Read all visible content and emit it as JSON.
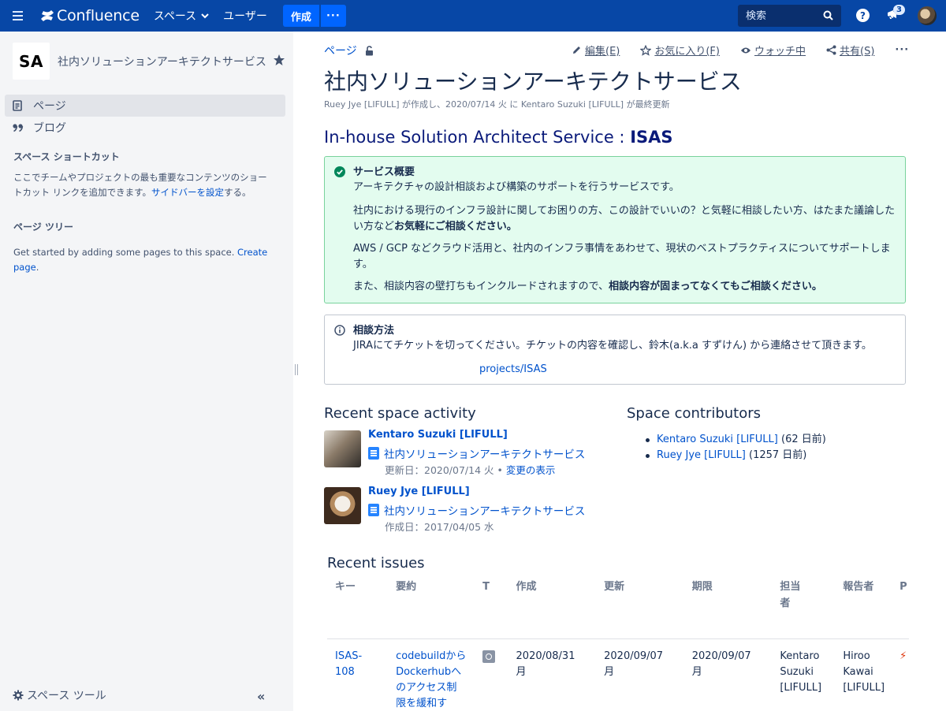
{
  "nav": {
    "brand": "Confluence",
    "spaces": "スペース",
    "users": "ユーザー",
    "create": "作成",
    "more": "···",
    "search_placeholder": "検索",
    "help": "?",
    "notification_count": "3"
  },
  "sidebar": {
    "logo_text": "SA",
    "space_name": "社内ソリューションアーキテクトサービス",
    "items": [
      {
        "label": "ページ",
        "icon": "page-icon"
      },
      {
        "label": "ブログ",
        "icon": "quote-icon"
      }
    ],
    "shortcuts_heading": "スペース ショートカット",
    "shortcuts_text": "ここでチームやプロジェクトの最も重要なコンテンツのショートカット リンクを追加できます。",
    "shortcuts_link": "サイドバーを設定",
    "shortcuts_suffix": "する。",
    "tree_heading": "ページ ツリー",
    "tree_text": "Get started by adding some pages to this space. ",
    "tree_link": "Create page",
    "tree_suffix": ".",
    "space_tools": "スペース ツール",
    "collapse": "«"
  },
  "page": {
    "breadcrumb": "ページ",
    "actions": {
      "edit": "編集(E)",
      "favorite": "お気に入り(F)",
      "watch": "ウォッチ中",
      "share": "共有(S)",
      "more": "···"
    },
    "title": "社内ソリューションアーキテクトサービス",
    "byline": "Ruey Jye [LIFULL] が作成し、2020/07/14 火 に Kentaro Suzuki [LIFULL] が最終更新",
    "heading_prefix": "In-house Solution Architect Service : ",
    "heading_bold": "ISAS",
    "success_panel": {
      "title": "サービス概要",
      "p1": "アーキテクチャの設計相談および構築のサポートを行うサービスです。",
      "p2_text": "社内における現行のインフラ設計に関してお困りの方、この設計でいいの？と気軽に相談したい方、はたまた議論したい方など",
      "p2_bold": "お気軽にご相談ください。",
      "p3": "AWS / GCP などクラウド活用と、社内のインフラ事情をあわせて、現状のベストプラクティスについてサポートします。",
      "p4_text": "また、相談内容の壁打ちもインクルードされますので、",
      "p4_bold": "相談内容が固まってなくてもご相談ください。"
    },
    "info_panel": {
      "title": "相談方法",
      "p1": "JIRAにてチケットを切ってください。チケットの内容を確認し、鈴木(a.k.a すずけん) から連絡させて頂きます。",
      "link": "projects/ISAS"
    }
  },
  "activity": {
    "heading": "Recent space activity",
    "items": [
      {
        "user": "Kentaro Suzuki [LIFULL]",
        "page": "社内ソリューションアーキテクトサービス",
        "meta": "更新日：2020/07/14 火 • ",
        "meta_link": "変更の表示"
      },
      {
        "user": "Ruey Jye [LIFULL]",
        "page": "社内ソリューションアーキテクトサービス",
        "meta": "作成日：2017/04/05 水",
        "meta_link": ""
      }
    ]
  },
  "contributors": {
    "heading": "Space contributors",
    "items": [
      {
        "name": "Kentaro Suzuki [LIFULL]",
        "when": " (62 日前)"
      },
      {
        "name": "Ruey Jye [LIFULL]",
        "when": " (1257 日前)"
      }
    ]
  },
  "issues": {
    "heading": "Recent issues",
    "columns": [
      "キー",
      "要約",
      "T",
      "作成",
      "更新",
      "期限",
      "担当者",
      "報告者",
      "P"
    ],
    "rows": [
      {
        "key": "ISAS-108",
        "summary": "codebuildからDockerhubへのアクセス制限を緩和す",
        "created": "2020/08/31 月",
        "updated": "2020/09/07 月",
        "due": "2020/09/07 月",
        "assignee": "Kentaro Suzuki [LIFULL]",
        "reporter": "Hiroo Kawai [LIFULL]"
      }
    ]
  },
  "colors": {
    "nav_bg": "#0747a6",
    "link": "#0052cc",
    "success_bg": "#e3fcef",
    "success_border": "#79d29c"
  }
}
